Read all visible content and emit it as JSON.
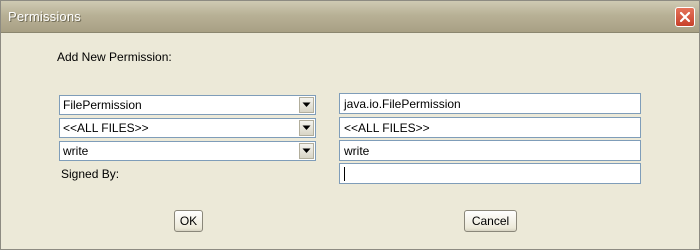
{
  "window": {
    "title": "Permissions"
  },
  "form": {
    "heading": "Add New Permission:",
    "permission_type": {
      "selected": "FilePermission"
    },
    "permission_class": {
      "value": "java.io.FilePermission"
    },
    "target_name": {
      "selected": "<<ALL FILES>>"
    },
    "target_value": {
      "value": "<<ALL FILES>>"
    },
    "actions": {
      "selected": "write"
    },
    "actions_value": {
      "value": "write"
    },
    "signed_by": {
      "label": "Signed By:",
      "value": ""
    }
  },
  "buttons": {
    "ok": "OK",
    "cancel": "Cancel"
  },
  "icons": {
    "close": "close-icon",
    "dropdown": "chevron-down-icon"
  }
}
